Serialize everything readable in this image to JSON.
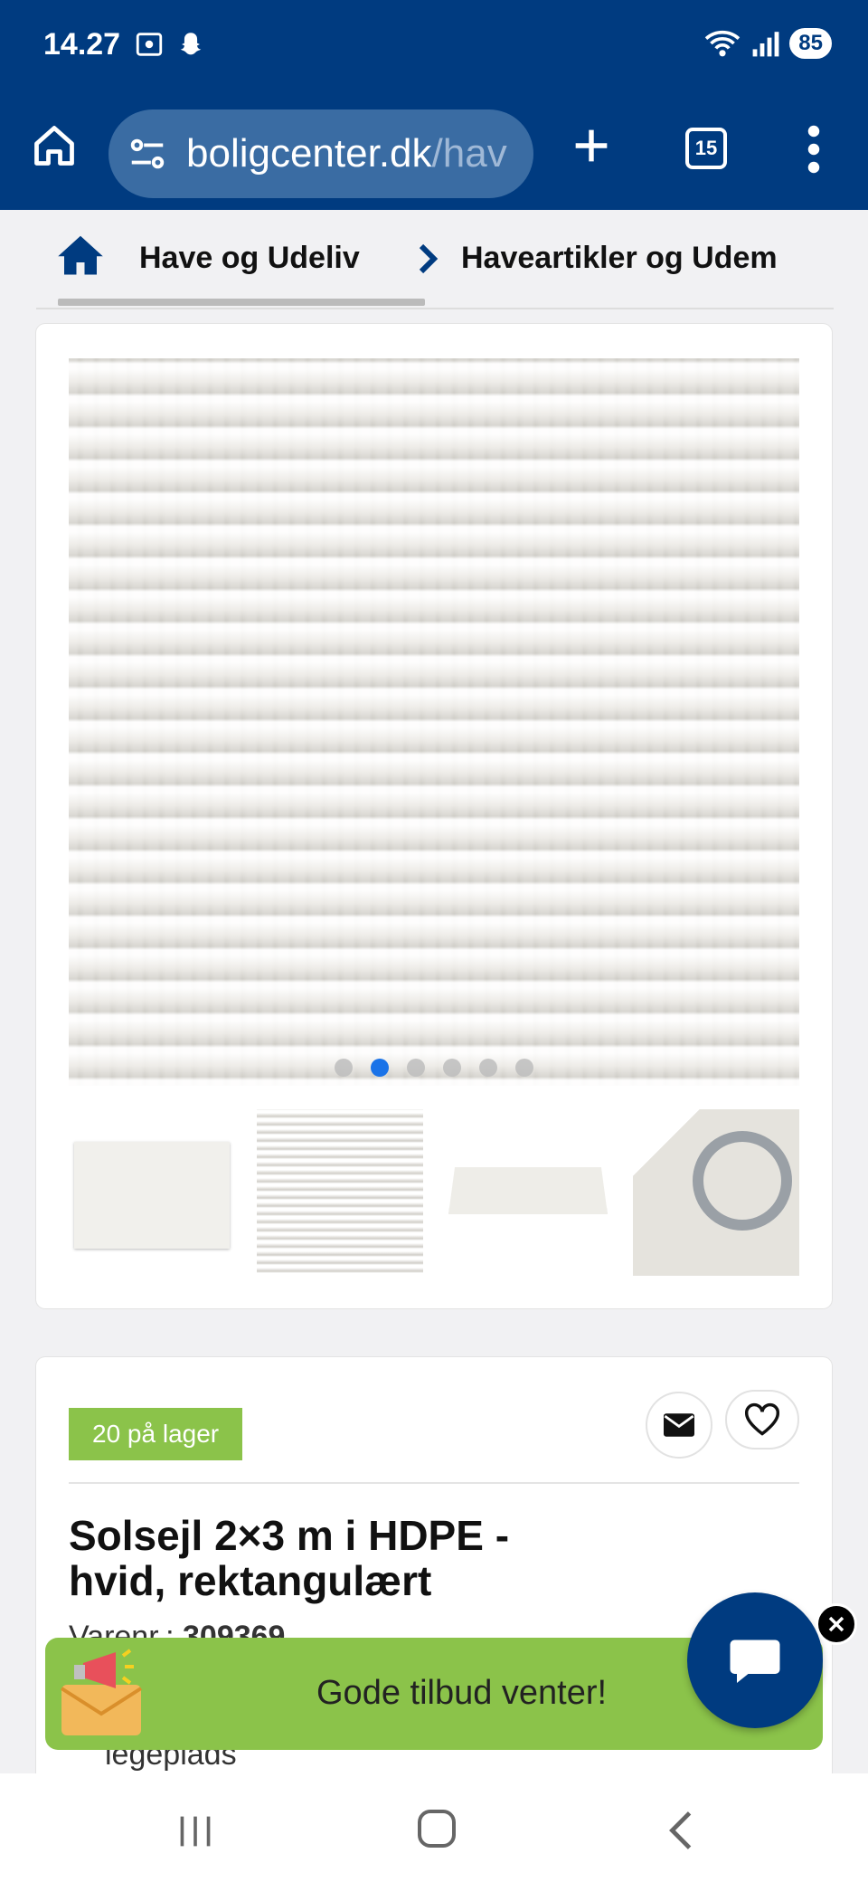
{
  "status_bar": {
    "time": "14.27",
    "battery": "85"
  },
  "browser": {
    "url_domain": "boligcenter.dk",
    "url_path": "/hav",
    "tab_count": "15"
  },
  "breadcrumb": {
    "items": [
      {
        "label": "Have og Udeliv"
      },
      {
        "label": "Haveartikler og Udem"
      }
    ]
  },
  "gallery": {
    "dots_count": 6,
    "active_dot": 2
  },
  "product": {
    "stock_badge": "20 på lager",
    "title": "Solsejl 2×3 m i HDPE - hvid, rektangulært",
    "varenr_label": "Varenr.:",
    "varenr_value": "309369",
    "cut_text": "legeplads"
  },
  "promo": {
    "text": "Gode tilbud venter!"
  },
  "colors": {
    "brand_blue": "#003b80",
    "promo_green": "#8bc34a",
    "active_dot": "#1a73e8"
  }
}
